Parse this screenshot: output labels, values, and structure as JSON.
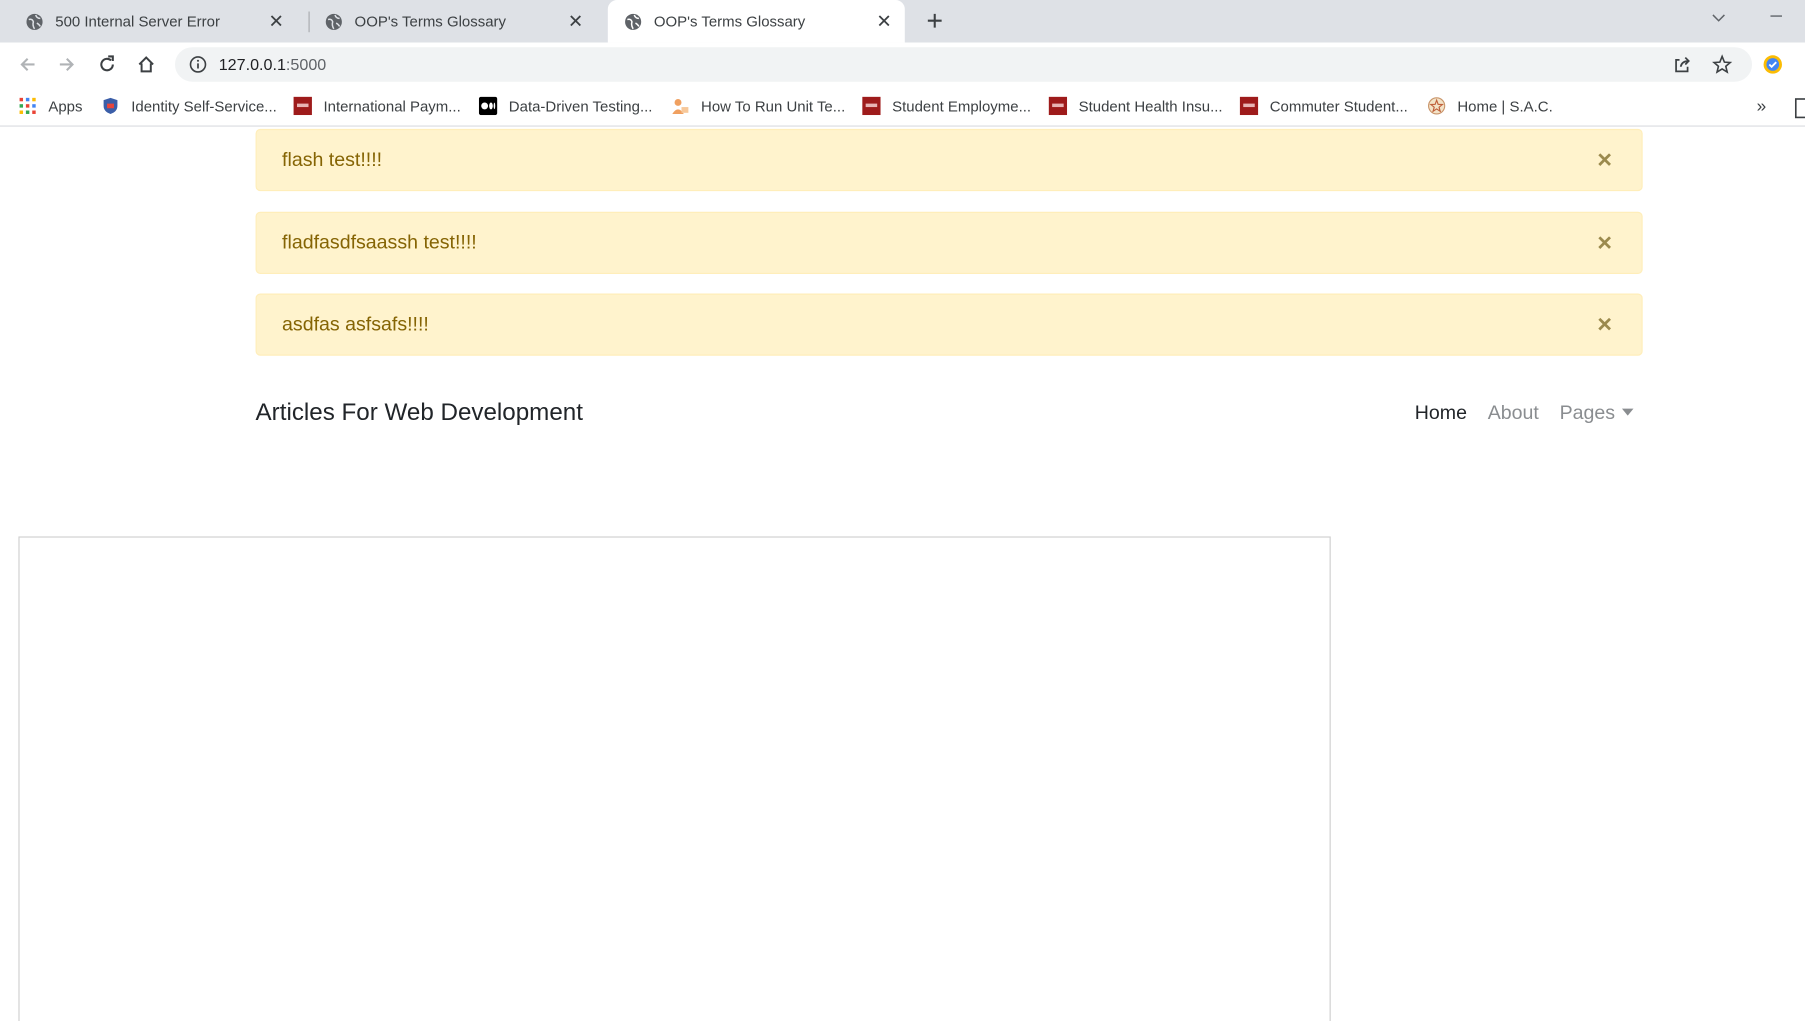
{
  "browser": {
    "tabs": [
      {
        "title": "500 Internal Server Error",
        "active": false
      },
      {
        "title": "OOP's Terms Glossary",
        "active": false
      },
      {
        "title": "OOP's Terms Glossary",
        "active": true
      }
    ],
    "url_host": "127.0.0.1",
    "url_port": ":5000",
    "bookmarks": [
      {
        "label": "Apps",
        "icon": "apps-grid-icon"
      },
      {
        "label": "Identity Self-Service...",
        "icon": "shield-icon"
      },
      {
        "label": "International Paym...",
        "icon": "university-icon"
      },
      {
        "label": "Data-Driven Testing...",
        "icon": "medium-icon"
      },
      {
        "label": "How To Run Unit Te...",
        "icon": "person-icon"
      },
      {
        "label": "Student Employme...",
        "icon": "university-icon"
      },
      {
        "label": "Student Health Insu...",
        "icon": "university-icon"
      },
      {
        "label": "Commuter Student...",
        "icon": "university-icon"
      },
      {
        "label": "Home | S.A.C.",
        "icon": "star-badge-icon"
      }
    ],
    "more_bookmarks": "»"
  },
  "alerts": [
    {
      "message": "flash test!!!!",
      "dismiss": "×"
    },
    {
      "message": "fladfasdfsaassh test!!!!",
      "dismiss": "×"
    },
    {
      "message": "asdfas asfsafs!!!!",
      "dismiss": "×"
    }
  ],
  "navbar": {
    "brand": "Articles For Web Development",
    "links": [
      {
        "label": "Home",
        "active": true
      },
      {
        "label": "About",
        "active": false
      },
      {
        "label": "Pages",
        "active": false,
        "dropdown": true
      }
    ]
  },
  "colors": {
    "alert_bg": "#fff3cd",
    "alert_text": "#856404",
    "tabstrip_bg": "#dee1e6"
  }
}
